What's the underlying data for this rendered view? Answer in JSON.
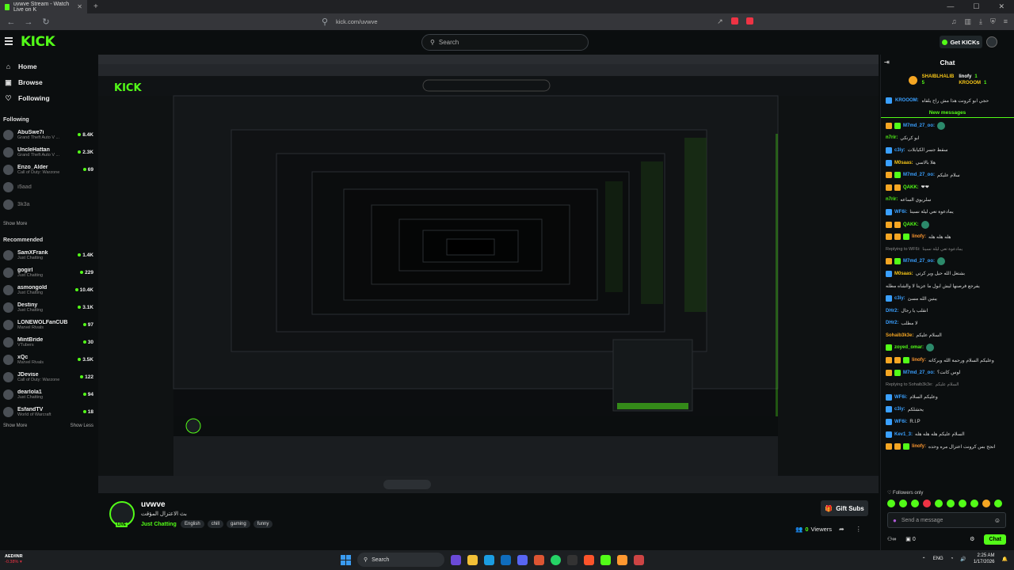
{
  "browser": {
    "tab_title": "uvwve Stream - Watch Live on K",
    "url": "kick.com/uvwve"
  },
  "header": {
    "logo": "KICK",
    "search_placeholder": "Search",
    "get_kicks": "Get KICKs"
  },
  "sidebar": {
    "nav": [
      {
        "label": "Home",
        "icon": "home-icon"
      },
      {
        "label": "Browse",
        "icon": "browse-icon"
      },
      {
        "label": "Following",
        "icon": "heart-icon"
      }
    ],
    "following_title": "Following",
    "following": [
      {
        "name": "AbuSwe7i",
        "category": "Grand Theft Auto V ...",
        "viewers": "8.4K",
        "live": true
      },
      {
        "name": "UncleHattan",
        "category": "Grand Theft Auto V ...",
        "viewers": "2.3K",
        "live": true
      },
      {
        "name": "Enzo_Alder",
        "category": "Call of Duty: Warzone",
        "viewers": "69",
        "live": true
      },
      {
        "name": "i5aad",
        "category": "",
        "viewers": "",
        "live": false
      },
      {
        "name": "3k3a",
        "category": "",
        "viewers": "",
        "live": false
      }
    ],
    "show_more": "Show More",
    "recommended_title": "Recommended",
    "recommended": [
      {
        "name": "SamXFrank",
        "category": "Just Chatting",
        "viewers": "1.4K"
      },
      {
        "name": "gogirl",
        "category": "Just Chatting",
        "viewers": "229"
      },
      {
        "name": "asmongold",
        "category": "Just Chatting",
        "viewers": "10.4K"
      },
      {
        "name": "Destiny",
        "category": "Just Chatting",
        "viewers": "3.1K"
      },
      {
        "name": "LONEWOLFanCUB",
        "category": "Marvel Rivals",
        "viewers": "97"
      },
      {
        "name": "MintBride",
        "category": "VTubers",
        "viewers": "30"
      },
      {
        "name": "xQc",
        "category": "Marvel Rivals",
        "viewers": "3.5K"
      },
      {
        "name": "JDevise",
        "category": "Call of Duty: Warzone",
        "viewers": "122"
      },
      {
        "name": "dearlola1",
        "category": "Just Chatting",
        "viewers": "94"
      },
      {
        "name": "EsfandTV",
        "category": "World of Warcraft",
        "viewers": "18"
      }
    ],
    "show_less": "Show Less"
  },
  "stream": {
    "channel": "uvwve",
    "title": "بث الاعتزال المؤقت",
    "category": "Just Chatting",
    "tags": [
      "English",
      "chill",
      "gaming",
      "funny"
    ],
    "live_badge": "LIVE",
    "gift_subs": "Gift Subs",
    "viewers": "0",
    "viewers_label": "Viewers"
  },
  "chat": {
    "title": "Chat",
    "leaderboard": [
      {
        "name": "SHAIBLHALIB",
        "count": "5"
      },
      {
        "name": "linofy",
        "count": "1"
      },
      {
        "name": "KROOOM",
        "count": "1"
      }
    ],
    "pinned": {
      "user": "KROOOM:",
      "text": "حجي ابو كرونت هذا مش راح يلقاه"
    },
    "new_messages": "New messages",
    "messages": [
      {
        "user": "M7md_27_oo:",
        "text": "",
        "color": "#3aa0ff",
        "badges": [
          "by",
          "bg"
        ]
      },
      {
        "user": "n7rir:",
        "text": "ابو كرنكي",
        "color": "#53fc18",
        "badges": []
      },
      {
        "user": "c3iy:",
        "text": "سقط جسر الكيابلات",
        "color": "#3aa0ff",
        "badges": [
          "bb"
        ]
      },
      {
        "user": "M0saas:",
        "text": "هلا بالاسي",
        "color": "#f5c518",
        "badges": [
          "bb"
        ]
      },
      {
        "user": "M7md_27_oo:",
        "text": "سلام عليكم",
        "color": "#3aa0ff",
        "badges": [
          "by",
          "bg"
        ]
      },
      {
        "user": "QAKK:",
        "text": "❤❤",
        "color": "#53fc18",
        "badges": [
          "by",
          "by"
        ]
      },
      {
        "user": "n7rir:",
        "text": "سلريوي الساعه",
        "color": "#53fc18",
        "badges": []
      },
      {
        "user": "WF6i:",
        "text": "يمادعوة تعي ليلة نسينا",
        "color": "#3aa0ff",
        "badges": [
          "bb"
        ]
      },
      {
        "user": "QAKK:",
        "text": "",
        "color": "#53fc18",
        "badges": [
          "by",
          "by"
        ]
      },
      {
        "user": "linofy:",
        "text": "هله هله هله",
        "color": "#ff9830",
        "badges": [
          "by",
          "by",
          "bg"
        ]
      },
      {
        "user": "Replying to WF6i:",
        "text": "يمادعوة تعي ليلة نسينا",
        "color": "#888",
        "badges": [],
        "reply": true
      },
      {
        "user": "M7md_27_oo:",
        "text": "",
        "color": "#3aa0ff",
        "badges": [
          "by",
          "bg"
        ]
      },
      {
        "user": "M0saas:",
        "text": "بشتغل الله حيل وير كرتي",
        "color": "#f5c518",
        "badges": [
          "bb"
        ]
      },
      {
        "user": "",
        "text": "يفرجع فرصنها ليش ابول ما عزينا لا والشاه مطله",
        "color": "#ddd",
        "badges": []
      },
      {
        "user": "c3iy:",
        "text": "يبتين الله مسئ",
        "color": "#3aa0ff",
        "badges": [
          "bb"
        ]
      },
      {
        "user": "DHr2:",
        "text": "انقلب يا رجال",
        "color": "#3aa0ff",
        "badges": []
      },
      {
        "user": "DHr2:",
        "text": "لا مطلب",
        "color": "#3aa0ff",
        "badges": []
      },
      {
        "user": "Sohaib3k3e:",
        "text": "السلام عليكم",
        "color": "#f5a623",
        "badges": []
      },
      {
        "user": "zoyed_omar:",
        "text": "",
        "color": "#53fc18",
        "badges": [
          "bg"
        ]
      },
      {
        "user": "linofy:",
        "text": "وعليكم السلام ورحمة الله وبركاته",
        "color": "#ff9830",
        "badges": [
          "by",
          "by",
          "bg"
        ]
      },
      {
        "user": "M7md_27_oo:",
        "text": "لوس كانت؟",
        "color": "#3aa0ff",
        "badges": [
          "by",
          "bg"
        ]
      },
      {
        "user": "Replying to Sohaib3k3e:",
        "text": "السلام عليكم",
        "color": "#888",
        "badges": [],
        "reply": true
      },
      {
        "user": "WF6i:",
        "text": "وعليكم السلام",
        "color": "#3aa0ff",
        "badges": [
          "bb"
        ]
      },
      {
        "user": "c3iy:",
        "text": "يحشلكم",
        "color": "#3aa0ff",
        "badges": [
          "bb"
        ]
      },
      {
        "user": "WF6i:",
        "text": "R.I.P",
        "color": "#3aa0ff",
        "badges": [
          "bb"
        ]
      },
      {
        "user": "Kev1_3:",
        "text": "السلام عليكم هله هله هله",
        "color": "#3aa0ff",
        "badges": [
          "bb"
        ]
      },
      {
        "user": "linofy:",
        "text": "انجح بس كرونت اعتزال مره وحده",
        "color": "#ff9830",
        "badges": [
          "by",
          "by",
          "bg"
        ]
      }
    ],
    "followers_only": "Followers only",
    "input_placeholder": "Send a message",
    "count": "0",
    "chat_button": "Chat"
  },
  "taskbar": {
    "ticker": "AED/INR",
    "ticker_change": "-0.38% ▾",
    "search": "Search",
    "lang": "ENG",
    "time": "2:25 AM",
    "date": "1/17/2026"
  }
}
